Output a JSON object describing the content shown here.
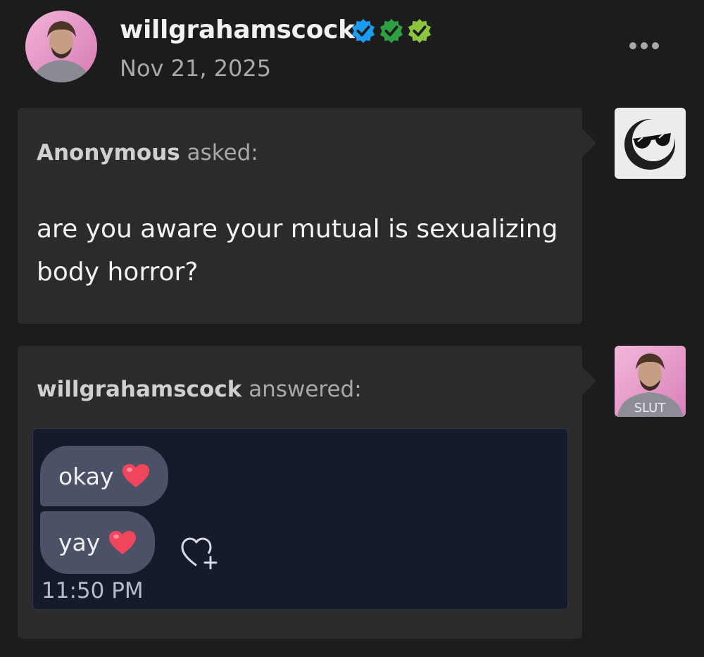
{
  "post": {
    "username": "willgrahamscock",
    "date": "Nov 21, 2025",
    "more_icon": "ellipsis-icon",
    "badges": [
      {
        "name": "blue-checkmark-badge",
        "color": "#1da1f2"
      },
      {
        "name": "green-checkmark-badge",
        "color": "#2ea043"
      },
      {
        "name": "lime-checkmark-badge",
        "color": "#7cc242"
      }
    ]
  },
  "ask": {
    "asker": "Anonymous",
    "verb": "asked:",
    "question": "are you aware your mutual is sexualizing body horror?",
    "avatar_icon": "anonymous-sunglasses-avatar"
  },
  "answer": {
    "answerer": "willgrahamscock",
    "verb": "answered:",
    "messages": [
      {
        "text": "okay",
        "emoji": "red-heart-emoji"
      },
      {
        "text": "yay",
        "emoji": "red-heart-emoji"
      }
    ],
    "react_icon": "heart-plus-icon",
    "time": "11:50 PM",
    "avatar_text": "SLUT"
  }
}
